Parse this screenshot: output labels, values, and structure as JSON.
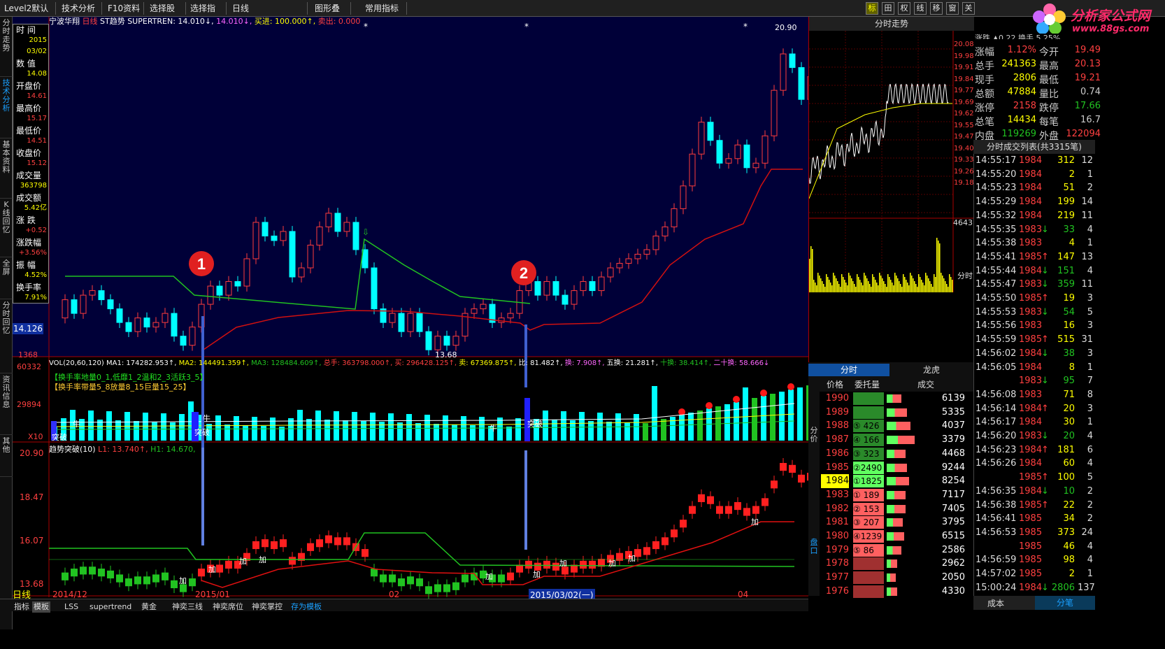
{
  "toolbar": {
    "items": [
      "Level2默认",
      "技术分析",
      "F10资料",
      "选择股票",
      "选择指标",
      "日线",
      "图形叠加",
      "常用指标"
    ],
    "icons": [
      "标",
      "田",
      "权",
      "线",
      "移",
      "窗",
      "关"
    ]
  },
  "logo": {
    "line1": "分析家公式网",
    "line2": "www.88gs.com"
  },
  "left_tabs": [
    "分时走势",
    "技术分析",
    "基本资料",
    "K线回忆",
    "全屏",
    "分时回忆",
    "资讯信息",
    "其他"
  ],
  "chart_header": {
    "stock": "宁波华翔",
    "period": "日线",
    "indicator": "ST趋势",
    "formula": "SUPERTREN: 14.010↓,",
    "v2": "14.010↓,",
    "buy": "买进: 100.000↑,",
    "sell": "卖出: 0.000"
  },
  "info_panel": [
    {
      "label": "时 间",
      "values": [
        "2015",
        "03/02"
      ]
    },
    {
      "label": "数 值",
      "values": [
        "14.08"
      ]
    },
    {
      "label": "开盘价",
      "values": [
        "14.61"
      ]
    },
    {
      "label": "最高价",
      "values": [
        "15.17"
      ]
    },
    {
      "label": "最低价",
      "values": [
        "14.51"
      ]
    },
    {
      "label": "收盘价",
      "values": [
        "15.12"
      ]
    },
    {
      "label": "成交量",
      "values": [
        "363798"
      ]
    },
    {
      "label": "成交额",
      "values": [
        "5.42亿"
      ]
    },
    {
      "label": "涨 跌",
      "values": [
        "+0.52"
      ]
    },
    {
      "label": "涨跌幅",
      "values": [
        "+3.56%"
      ]
    },
    {
      "label": "振 幅",
      "values": [
        "4.52%"
      ]
    },
    {
      "label": "换手率",
      "values": [
        "7.91%"
      ]
    }
  ],
  "price_tags": {
    "cursor": "14.126",
    "low_axis": "1368",
    "max_label": "20.90",
    "min_label": "13.68",
    "top_axis": "20.90"
  },
  "markers": [
    "1",
    "2"
  ],
  "vol_header": {
    "t": "VOL(20,60,120)",
    "ma1": "MA1: 174282.953↑,",
    "ma2": "MA2: 144491.359↑,",
    "ma3": "MA3: 128484.609↑,",
    "total": "总手: 363798.000↑,",
    "buy": "买: 296428.125↑,",
    "sell": "卖: 67369.875↑,",
    "ratio": "比: 81.482↑,",
    "huan": "换: 7.908↑,",
    "wu": "五换: 21.281↑,",
    "shi": "十换: 38.414↑,",
    "ershi": "二十换: 58.666↓"
  },
  "vol_notes": [
    "【换手率地量0_1,低靡1_2温和2_3活跃3_5】",
    "【换手率带量5_8放量8_15巨量15_25】"
  ],
  "vol_axis": [
    "60332",
    "29894",
    "X10"
  ],
  "vol_labels": [
    "突破",
    "牛",
    "突破",
    "牛",
    "牛",
    "突破"
  ],
  "trend_header": {
    "name": "趋势突破(10)",
    "l1": "L1: 13.740↑,",
    "h1": "H1: 14.670,"
  },
  "trend_axis": [
    "20.90",
    "18.47",
    "16.07",
    "13.68"
  ],
  "trend_labels": [
    "加",
    "加",
    "加",
    "加",
    "加",
    "加",
    "加",
    "加",
    "加",
    "加"
  ],
  "date_axis": [
    "2014/12",
    "2015/01",
    "02",
    "2015/03/02(一)",
    "04"
  ],
  "bottom_tabs": [
    "日线",
    "指标",
    "模板",
    "LSS",
    "supertrend",
    "黄金",
    "神奕三线",
    "神奕席位",
    "神奕掌控",
    "存为模板"
  ],
  "intraday": {
    "title": "分时走势",
    "axis": [
      "20.08",
      "19.98",
      "19.91",
      "19.84",
      "19.77",
      "19.69",
      "19.62",
      "19.55",
      "19.47",
      "19.40",
      "19.33",
      "19.26",
      "19.18"
    ],
    "vol_top": "4643",
    "vol_label": "分时"
  },
  "quote": {
    "rows": [
      [
        "涨幅",
        "1.12%",
        "今开",
        "19.49"
      ],
      [
        "总手",
        "241363",
        "最高",
        "20.13"
      ],
      [
        "现手",
        "2806",
        "最低",
        "19.21"
      ],
      [
        "总额",
        "47884",
        "量比",
        "0.74"
      ],
      [
        "涨停",
        "2158",
        "跌停",
        "17.66"
      ],
      [
        "总笔",
        "14434",
        "每笔",
        "16.7"
      ],
      [
        "内盘",
        "119269",
        "外盘",
        "122094"
      ]
    ],
    "partial": "涨跌 ▲0.22 换手 5.25%"
  },
  "trades_title": "分时成交列表(共3315笔)",
  "trades": [
    [
      "14:55:17",
      "1984",
      "",
      "312",
      "12"
    ],
    [
      "14:55:20",
      "1984",
      "",
      "2",
      "1"
    ],
    [
      "14:55:23",
      "1984",
      "",
      "51",
      "2"
    ],
    [
      "14:55:29",
      "1984",
      "",
      "199",
      "14"
    ],
    [
      "14:55:32",
      "1984",
      "",
      "219",
      "11"
    ],
    [
      "14:55:35",
      "1983",
      "↓",
      "33",
      "4"
    ],
    [
      "14:55:38",
      "1983",
      "",
      "4",
      "1"
    ],
    [
      "14:55:41",
      "1985",
      "↑",
      "147",
      "13"
    ],
    [
      "14:55:44",
      "1984",
      "↓",
      "151",
      "4"
    ],
    [
      "14:55:47",
      "1983",
      "↓",
      "359",
      "11"
    ],
    [
      "14:55:50",
      "1985",
      "↑",
      "19",
      "3"
    ],
    [
      "14:55:53",
      "1983",
      "↓",
      "54",
      "5"
    ],
    [
      "14:55:56",
      "1983",
      "",
      "16",
      "3"
    ],
    [
      "14:55:59",
      "1985",
      "↑",
      "515",
      "31"
    ],
    [
      "14:56:02",
      "1984",
      "↓",
      "38",
      "3"
    ],
    [
      "14:56:05",
      "1984",
      "",
      "8",
      "1"
    ],
    [
      "",
      "1983",
      "↓",
      "95",
      "7"
    ],
    [
      "14:56:08",
      "1983",
      "",
      "71",
      "8"
    ],
    [
      "14:56:14",
      "1984",
      "↑",
      "20",
      "3"
    ],
    [
      "14:56:17",
      "1984",
      "",
      "30",
      "1"
    ],
    [
      "14:56:20",
      "1983",
      "↓",
      "20",
      "4"
    ],
    [
      "14:56:23",
      "1984",
      "↑",
      "181",
      "6"
    ],
    [
      "14:56:26",
      "1984",
      "",
      "60",
      "4"
    ],
    [
      "",
      "1985",
      "↑",
      "100",
      "5"
    ],
    [
      "14:56:35",
      "1984",
      "↓",
      "10",
      "2"
    ],
    [
      "14:56:38",
      "1985",
      "↑",
      "22",
      "2"
    ],
    [
      "14:56:41",
      "1985",
      "",
      "34",
      "2"
    ],
    [
      "14:56:53",
      "1985",
      "",
      "373",
      "24"
    ],
    [
      "",
      "1985",
      "",
      "46",
      "4"
    ],
    [
      "14:56:59",
      "1985",
      "",
      "98",
      "4"
    ],
    [
      "14:57:02",
      "1985",
      "",
      "2",
      "1"
    ],
    [
      "15:00:24",
      "1984",
      "↓",
      "2806",
      "137"
    ]
  ],
  "trades_tabs": [
    "成本",
    "分笔"
  ],
  "order": {
    "tabs": [
      "分时",
      "龙虎"
    ],
    "headers": [
      "价格",
      "委托量",
      "成交"
    ],
    "side_left": "分价",
    "side_left2": "盘口",
    "rows": [
      [
        "1990",
        "",
        "6139"
      ],
      [
        "1989",
        "",
        "5335"
      ],
      [
        "1988",
        "⑤ 426",
        "4037"
      ],
      [
        "1987",
        "④ 166",
        "3379"
      ],
      [
        "1986",
        "③ 323",
        "4468"
      ],
      [
        "1985",
        "②2490",
        "9244"
      ],
      [
        "1984",
        "①1825",
        "8254"
      ],
      [
        "1983",
        "① 189",
        "7117"
      ],
      [
        "1982",
        "② 153",
        "7405"
      ],
      [
        "1981",
        "③ 207",
        "3795"
      ],
      [
        "1980",
        "④1239",
        "6515"
      ],
      [
        "1979",
        "⑤ 86",
        "2586"
      ],
      [
        "1978",
        "",
        "2962"
      ],
      [
        "1977",
        "",
        "2050"
      ],
      [
        "1976",
        "",
        "4330"
      ]
    ]
  },
  "colors": {
    "up": "#ff3c3c",
    "down": "#00ffff",
    "green": "#21c321",
    "red": "#d01010",
    "panel_bg": "#000040",
    "volbar": "#00ffff"
  }
}
